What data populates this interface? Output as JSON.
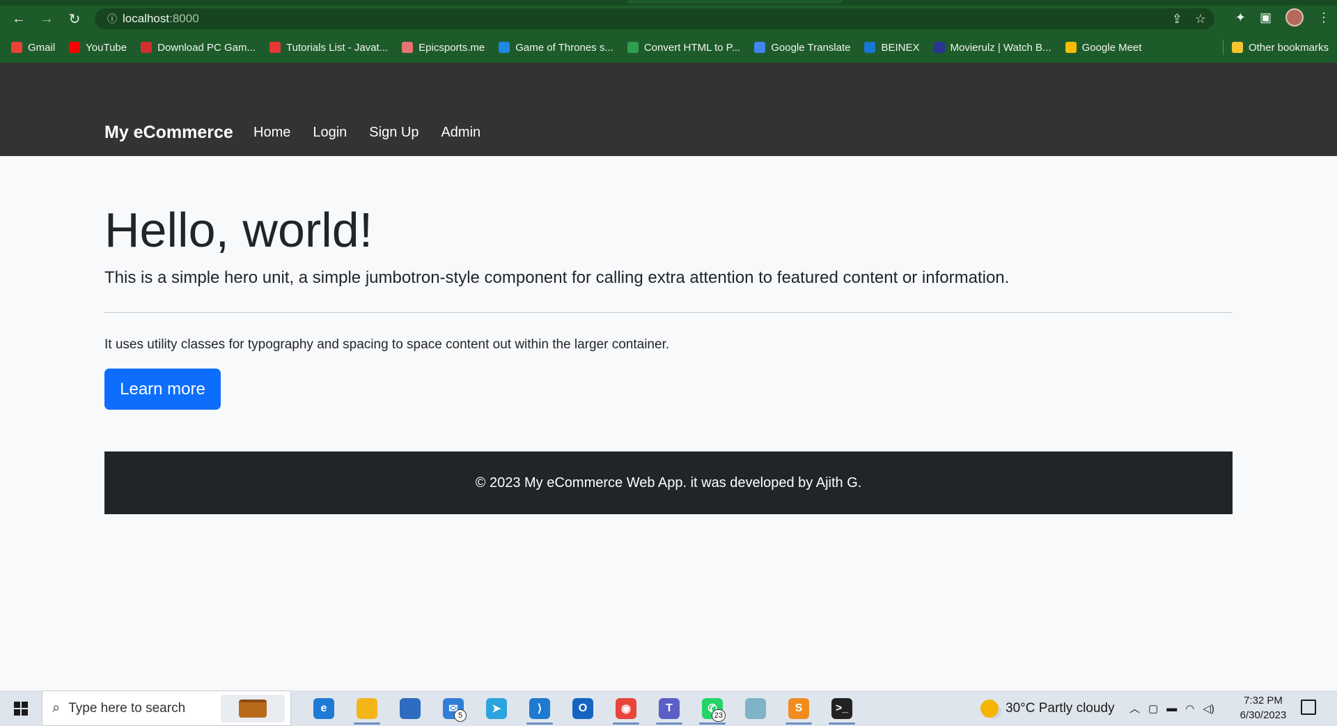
{
  "browser": {
    "url_host": "localhost",
    "url_port": ":8000",
    "bookmarks": [
      {
        "label": "Gmail",
        "color": "#ea4335"
      },
      {
        "label": "YouTube",
        "color": "#ff0000"
      },
      {
        "label": "Download PC Gam...",
        "color": "#d32f2f"
      },
      {
        "label": "Tutorials List - Javat...",
        "color": "#e53935"
      },
      {
        "label": "Epicsports.me",
        "color": "#e57373"
      },
      {
        "label": "Game of Thrones s...",
        "color": "#1e88e5"
      },
      {
        "label": "Convert HTML to P...",
        "color": "#2e9f4e"
      },
      {
        "label": "Google Translate",
        "color": "#4285f4"
      },
      {
        "label": "BEINEX",
        "color": "#1976d2"
      },
      {
        "label": "Movierulz | Watch B...",
        "color": "#283593"
      },
      {
        "label": "Google Meet",
        "color": "#fbbc04"
      }
    ],
    "other_bookmarks": "Other bookmarks"
  },
  "site": {
    "brand": "My eCommerce",
    "nav": [
      "Home",
      "Login",
      "Sign Up",
      "Admin"
    ],
    "hero": {
      "title": "Hello, world!",
      "lead": "This is a simple hero unit, a simple jumbotron-style component for calling extra attention to featured content or information.",
      "text": "It uses utility classes for typography and spacing to space content out within the larger container.",
      "button": "Learn more"
    },
    "footer": "© 2023 My eCommerce Web App. it was developed by Ajith G."
  },
  "taskbar": {
    "search_placeholder": "Type here to search",
    "apps": [
      {
        "name": "edge",
        "color": "#1f7ad6",
        "glyph": "e"
      },
      {
        "name": "file-explorer",
        "color": "#f2b619",
        "glyph": ""
      },
      {
        "name": "store",
        "color": "#2d6cc0",
        "glyph": ""
      },
      {
        "name": "mail",
        "color": "#2f7fd8",
        "glyph": "✉",
        "badge": "5"
      },
      {
        "name": "telegram",
        "color": "#2aa3df",
        "glyph": "➤"
      },
      {
        "name": "vscode",
        "color": "#1e7ad0",
        "glyph": "⟩"
      },
      {
        "name": "outlook",
        "color": "#1565c0",
        "glyph": "O"
      },
      {
        "name": "chrome",
        "color": "#e8453c",
        "glyph": "◉"
      },
      {
        "name": "teams",
        "color": "#5b5fc7",
        "glyph": "T"
      },
      {
        "name": "whatsapp",
        "color": "#25d366",
        "glyph": "✆",
        "badge": "23"
      },
      {
        "name": "notes-app",
        "color": "#7fb3c8",
        "glyph": ""
      },
      {
        "name": "sublime-text",
        "color": "#f08c1e",
        "glyph": "S"
      },
      {
        "name": "terminal",
        "color": "#222222",
        "glyph": ">_"
      }
    ],
    "weather": "30°C  Partly cloudy",
    "time": "7:32 PM",
    "date": "6/30/2023"
  }
}
